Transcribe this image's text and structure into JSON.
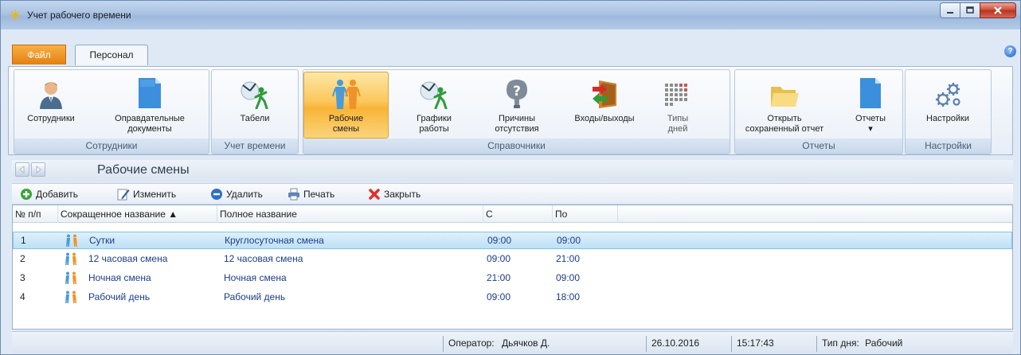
{
  "window": {
    "title": "Учет рабочего времени",
    "controls": [
      "minimize",
      "maximize",
      "close"
    ]
  },
  "tabs": {
    "file": "Файл",
    "personal": "Персонал"
  },
  "ribbon": {
    "groups": [
      {
        "label": "Сотрудники",
        "buttons": [
          {
            "label": "Сотрудники",
            "icon": "employee-icon"
          },
          {
            "label": "Оправдательные\nдокументы",
            "icon": "document-icon"
          }
        ]
      },
      {
        "label": "Учет времени",
        "buttons": [
          {
            "label": "Табели",
            "icon": "timesheet-icon"
          }
        ]
      },
      {
        "label": "Справочники",
        "buttons": [
          {
            "label": "Рабочие\nсмены",
            "icon": "shifts-icon",
            "active": true
          },
          {
            "label": "Графики\nработы",
            "icon": "schedules-icon"
          },
          {
            "label": "Причины\nотсутствия",
            "icon": "absence-reasons-icon"
          },
          {
            "label": "Входы/выходы",
            "icon": "entries-exits-icon"
          },
          {
            "label": "Типы\nдней",
            "icon": "day-types-icon",
            "disabled": true
          }
        ]
      },
      {
        "label": "Отчеты",
        "buttons": [
          {
            "label": "Открыть\nсохраненный отчет",
            "icon": "open-folder-icon"
          },
          {
            "label": "Отчеты\n▾",
            "icon": "reports-icon"
          }
        ]
      },
      {
        "label": "Настройки",
        "buttons": [
          {
            "label": "Настройки",
            "icon": "settings-gears-icon"
          }
        ]
      }
    ]
  },
  "section": {
    "title": "Рабочие смены"
  },
  "toolbar": {
    "add": "Добавить",
    "edit": "Изменить",
    "delete": "Удалить",
    "print": "Печать",
    "close": "Закрыть"
  },
  "grid": {
    "columns": [
      "№ п/п",
      "Сокращенное название ▲",
      "Полное название",
      "С",
      "По"
    ],
    "rows": [
      {
        "num": "1",
        "short": "Сутки",
        "full": "Круглосуточная смена",
        "from": "09:00",
        "to": "09:00",
        "selected": true
      },
      {
        "num": "2",
        "short": "12 часовая смена",
        "full": "12 часовая смена",
        "from": "09:00",
        "to": "21:00"
      },
      {
        "num": "3",
        "short": "Ночная смена",
        "full": "Ночная смена",
        "from": "21:00",
        "to": "09:00"
      },
      {
        "num": "4",
        "short": "Рабочий день",
        "full": "Рабочий день",
        "from": "09:00",
        "to": "18:00"
      }
    ]
  },
  "status": {
    "operator_label": "Оператор:",
    "operator_name": "Дьячков Д.",
    "date": "26.10.2016",
    "time": "15:17:43",
    "daytype_label": "Тип дня:",
    "daytype_value": "Рабочий"
  },
  "colors": {
    "accent_orange": "#f39c1a",
    "selection_blue": "#bde0f6",
    "ribbon_bg": "#eef3f9",
    "text_blue": "#1c3d8a",
    "person_orange": "#f0922a",
    "person_blue": "#4a9bd8"
  }
}
